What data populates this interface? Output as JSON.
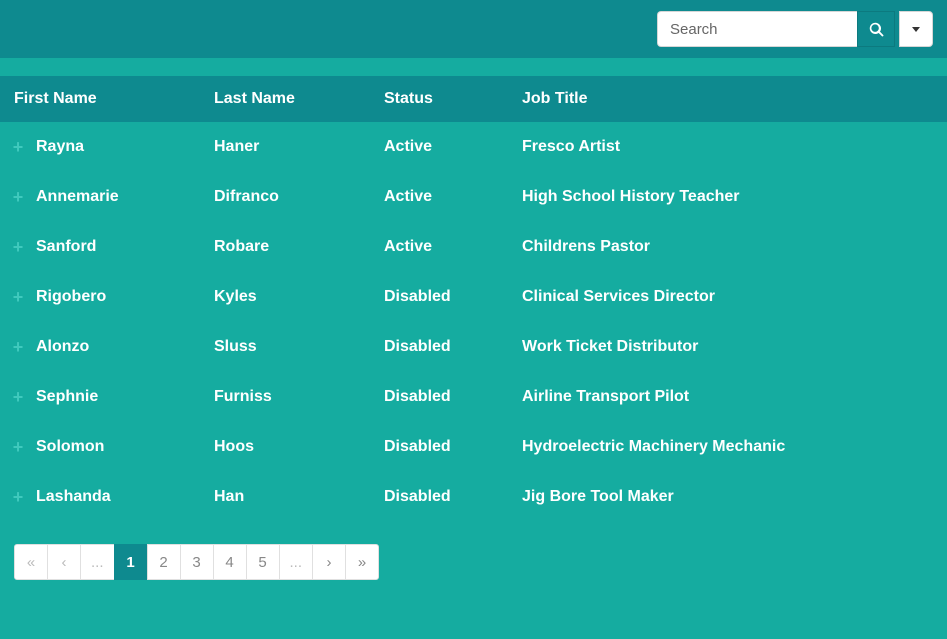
{
  "search": {
    "placeholder": "Search"
  },
  "columns": {
    "first_name": "First Name",
    "last_name": "Last Name",
    "status": "Status",
    "job_title": "Job Title"
  },
  "rows": [
    {
      "first": "Rayna",
      "last": "Haner",
      "status": "Active",
      "job": "Fresco Artist"
    },
    {
      "first": "Annemarie",
      "last": "Difranco",
      "status": "Active",
      "job": "High School History Teacher"
    },
    {
      "first": "Sanford",
      "last": "Robare",
      "status": "Active",
      "job": "Childrens Pastor"
    },
    {
      "first": "Rigobero",
      "last": "Kyles",
      "status": "Disabled",
      "job": "Clinical Services Director"
    },
    {
      "first": "Alonzo",
      "last": "Sluss",
      "status": "Disabled",
      "job": "Work Ticket Distributor"
    },
    {
      "first": "Sephnie",
      "last": "Furniss",
      "status": "Disabled",
      "job": "Airline Transport Pilot"
    },
    {
      "first": "Solomon",
      "last": "Hoos",
      "status": "Disabled",
      "job": "Hydroelectric Machinery Mechanic"
    },
    {
      "first": "Lashanda",
      "last": "Han",
      "status": "Disabled",
      "job": "Jig Bore Tool Maker"
    }
  ],
  "pagination": {
    "first": "«",
    "prev": "‹",
    "ellipsis": "...",
    "pages": [
      "1",
      "2",
      "3",
      "4",
      "5"
    ],
    "active_index": 0,
    "next": "›",
    "last": "»"
  }
}
